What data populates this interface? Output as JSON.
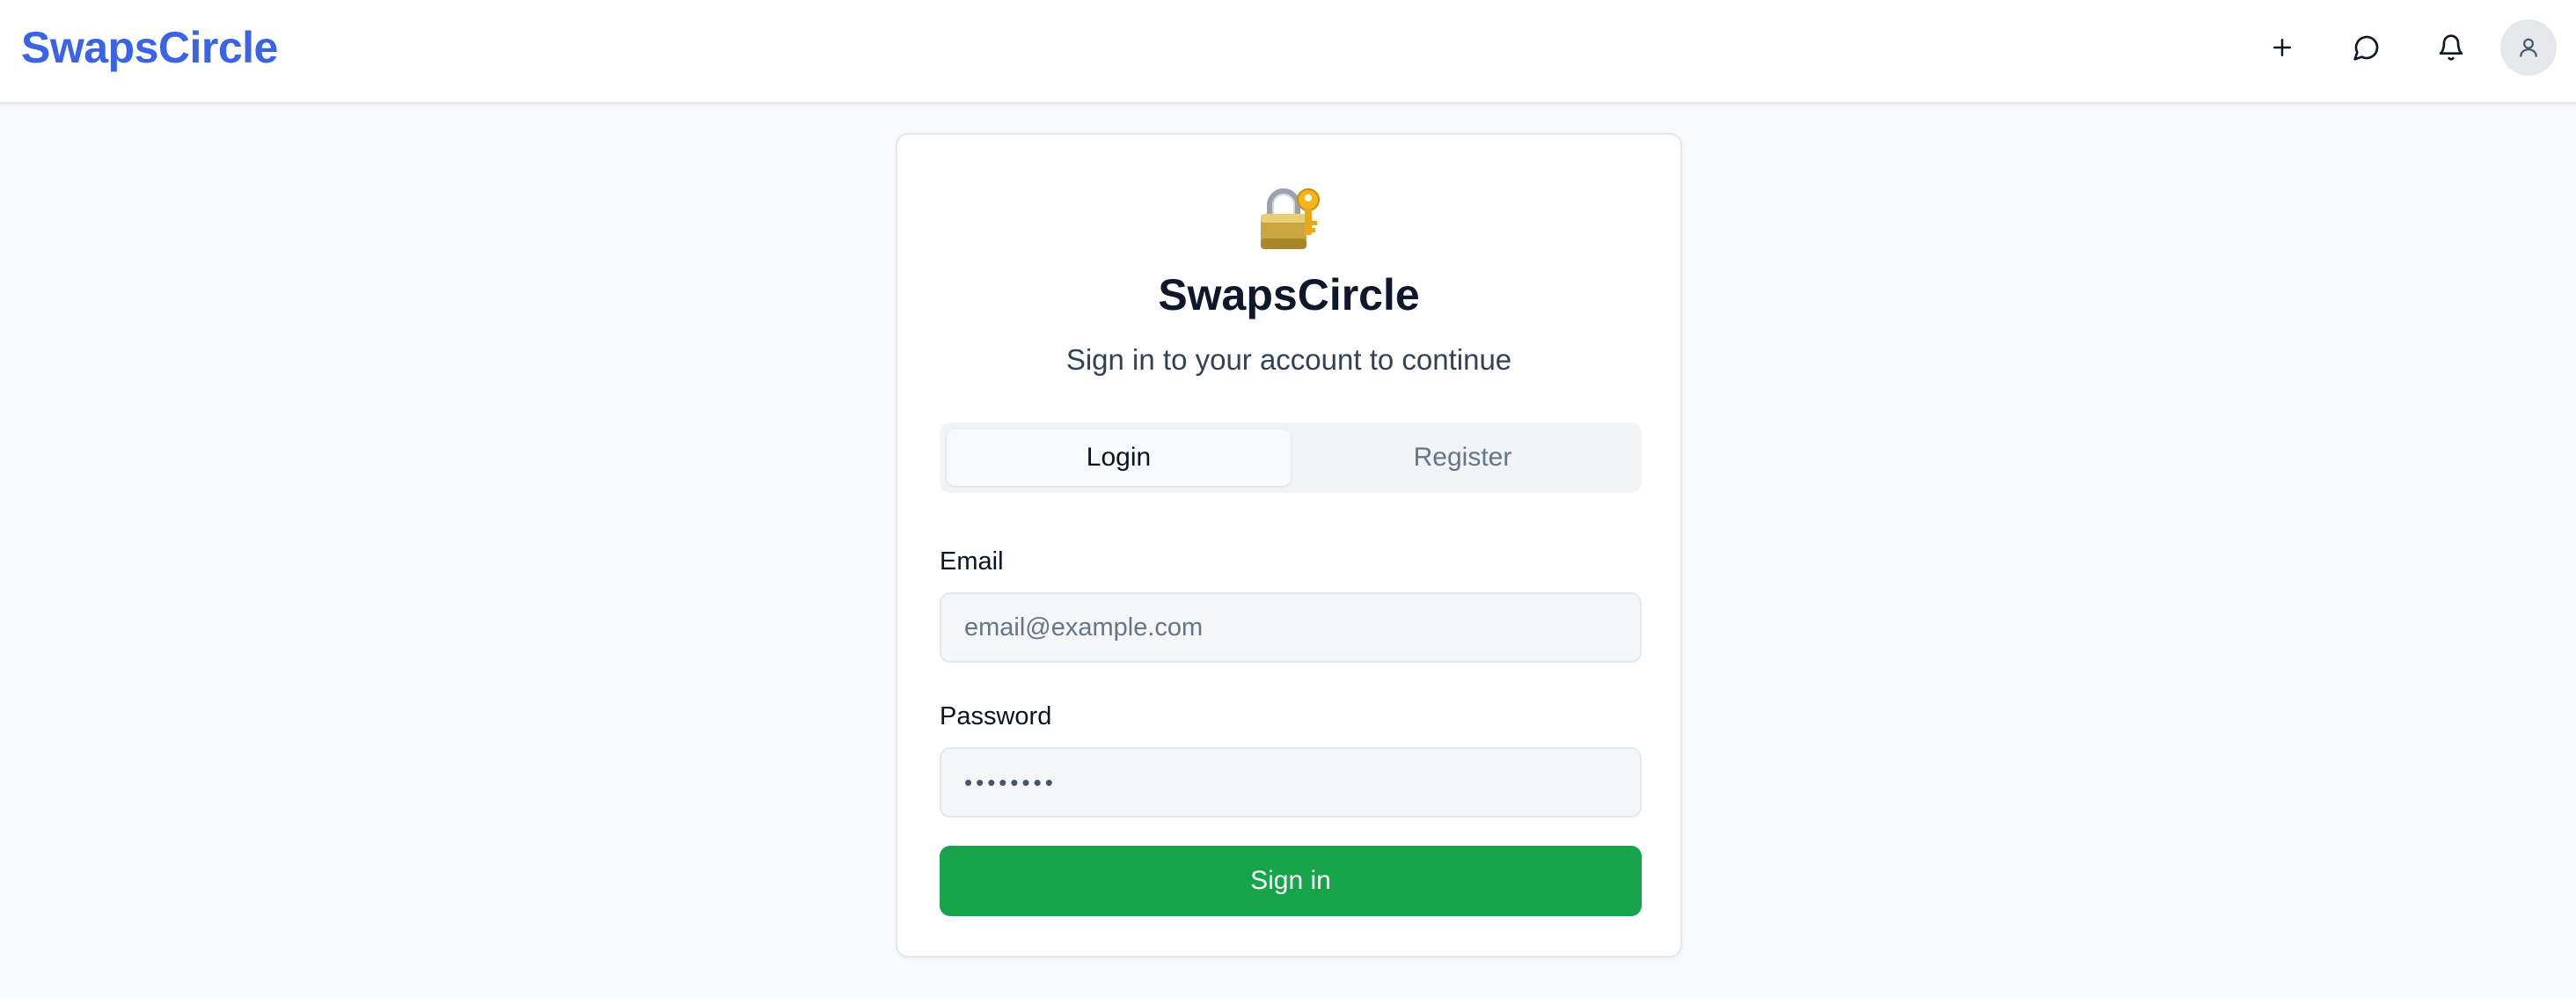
{
  "header": {
    "brand": "SwapsCircle",
    "brand_color": "#3b63e6",
    "actions": [
      {
        "name": "create",
        "icon": "plus-icon"
      },
      {
        "name": "messages",
        "icon": "chat-bubble-icon"
      },
      {
        "name": "notifications",
        "icon": "bell-icon"
      },
      {
        "name": "account",
        "icon": "user-icon"
      }
    ]
  },
  "auth_card": {
    "icon": "lock-with-key-icon",
    "title": "SwapsCircle",
    "subtitle": "Sign in to your account to continue",
    "tabs": [
      {
        "label": "Login",
        "active": true
      },
      {
        "label": "Register",
        "active": false
      }
    ],
    "email": {
      "label": "Email",
      "placeholder": "email@example.com",
      "value": ""
    },
    "password": {
      "label": "Password",
      "value": "••••••••"
    },
    "submit_label": "Sign in",
    "submit_color": "#16a34a"
  }
}
